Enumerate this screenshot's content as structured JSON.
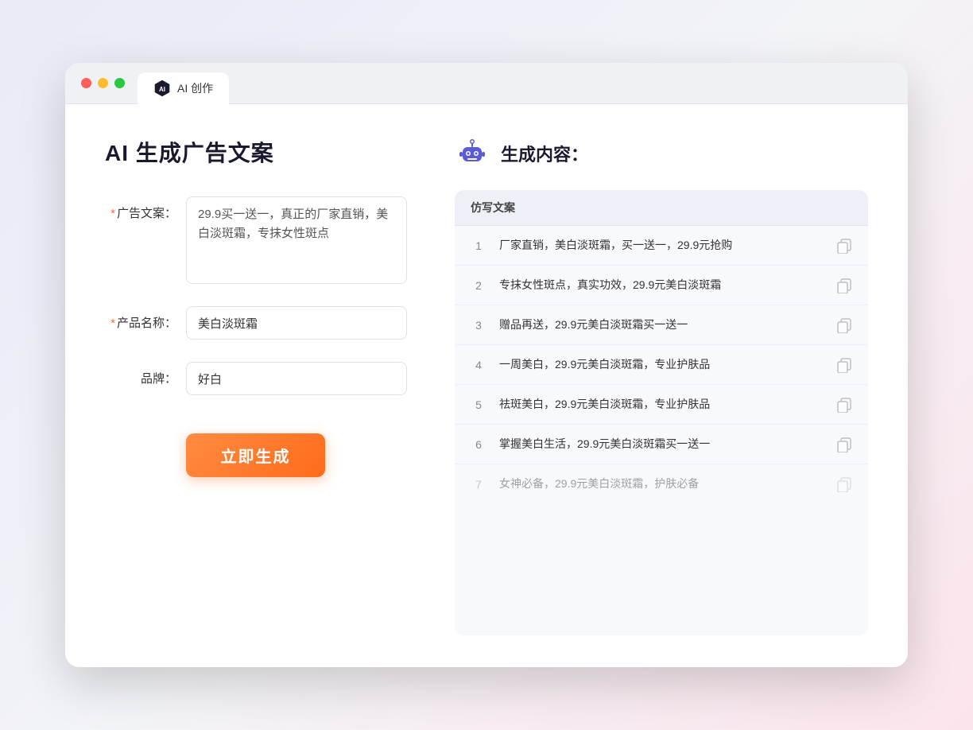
{
  "window": {
    "tab_title": "AI 创作",
    "traffic_lights": [
      "red",
      "yellow",
      "green"
    ]
  },
  "left_panel": {
    "page_title": "AI 生成广告文案",
    "form": {
      "ad_copy_label": "广告文案：",
      "ad_copy_required": true,
      "ad_copy_value": "29.9买一送一，真正的厂家直销，美白淡斑霜，专抹女性斑点",
      "product_name_label": "产品名称：",
      "product_name_required": true,
      "product_name_value": "美白淡斑霜",
      "brand_label": "品牌：",
      "brand_required": false,
      "brand_value": "好白"
    },
    "generate_button_label": "立即生成"
  },
  "right_panel": {
    "title": "生成内容：",
    "results_header": "仿写文案",
    "results": [
      {
        "id": 1,
        "text": "厂家直销，美白淡斑霜，买一送一，29.9元抢购",
        "faded": false
      },
      {
        "id": 2,
        "text": "专抹女性斑点，真实功效，29.9元美白淡斑霜",
        "faded": false
      },
      {
        "id": 3,
        "text": "赠品再送，29.9元美白淡斑霜买一送一",
        "faded": false
      },
      {
        "id": 4,
        "text": "一周美白，29.9元美白淡斑霜，专业护肤品",
        "faded": false
      },
      {
        "id": 5,
        "text": "祛斑美白，29.9元美白淡斑霜，专业护肤品",
        "faded": false
      },
      {
        "id": 6,
        "text": "掌握美白生活，29.9元美白淡斑霜买一送一",
        "faded": false
      },
      {
        "id": 7,
        "text": "女神必备，29.9元美白淡斑霜，护肤必备",
        "faded": true
      }
    ]
  }
}
